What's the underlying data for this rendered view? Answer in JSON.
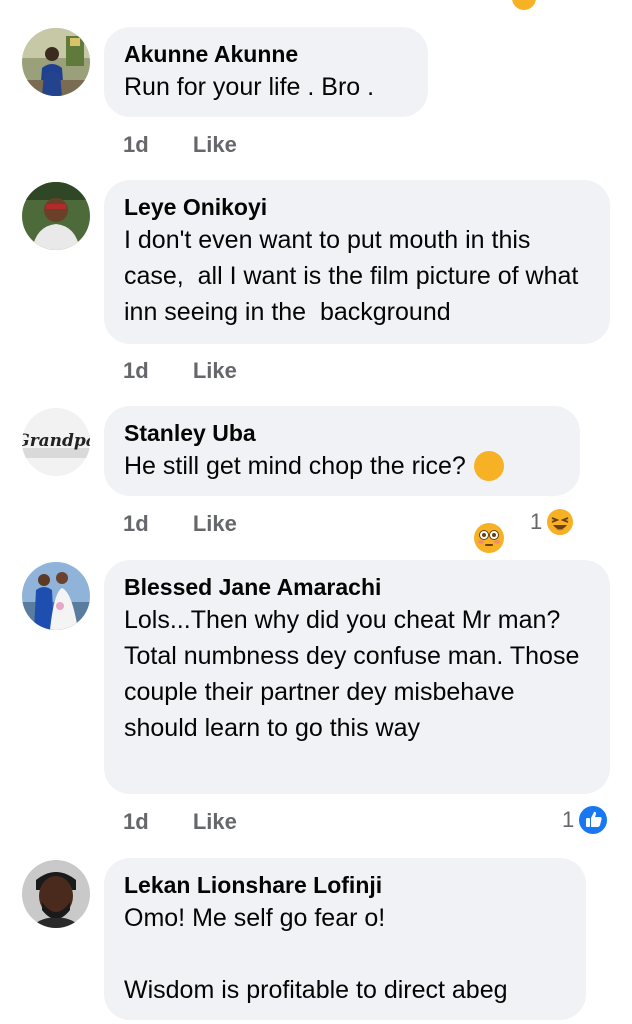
{
  "comments": [
    {
      "name": "Akunne Akunne",
      "text": "Run for your life . Bro .",
      "time": "1d",
      "like": "Like"
    },
    {
      "name": "Leye Onikoyi",
      "text": "I don't even want to put mouth in this case,  all I want is the film picture of what inn seeing in the  background",
      "time": "1d",
      "like": "Like"
    },
    {
      "name": "Stanley Uba",
      "text": "He still get mind chop the rice?",
      "time": "1d",
      "like": "Like",
      "reaction_count": "1",
      "reaction_icon": "laughing-emoji-icon",
      "avatar_text": "Grandpa"
    },
    {
      "name": "Blessed Jane Amarachi",
      "text": "Lols...Then why did you cheat Mr man? Total numbness dey confuse man. Those couple their partner dey misbehave should learn to go this way",
      "time": "1d",
      "like": "Like",
      "reaction_count": "1",
      "reaction_icon": "like-thumb-icon"
    },
    {
      "name": "Lekan Lionshare Lofinji",
      "text": "Omo! Me self go fear o!\n\nWisdom is profitable to direct abeg"
    }
  ],
  "colors": {
    "bubble": "#f0f2f5",
    "meta": "#65676b",
    "like_blue": "#1877f2",
    "emoji_yellow": "#f7b125"
  }
}
